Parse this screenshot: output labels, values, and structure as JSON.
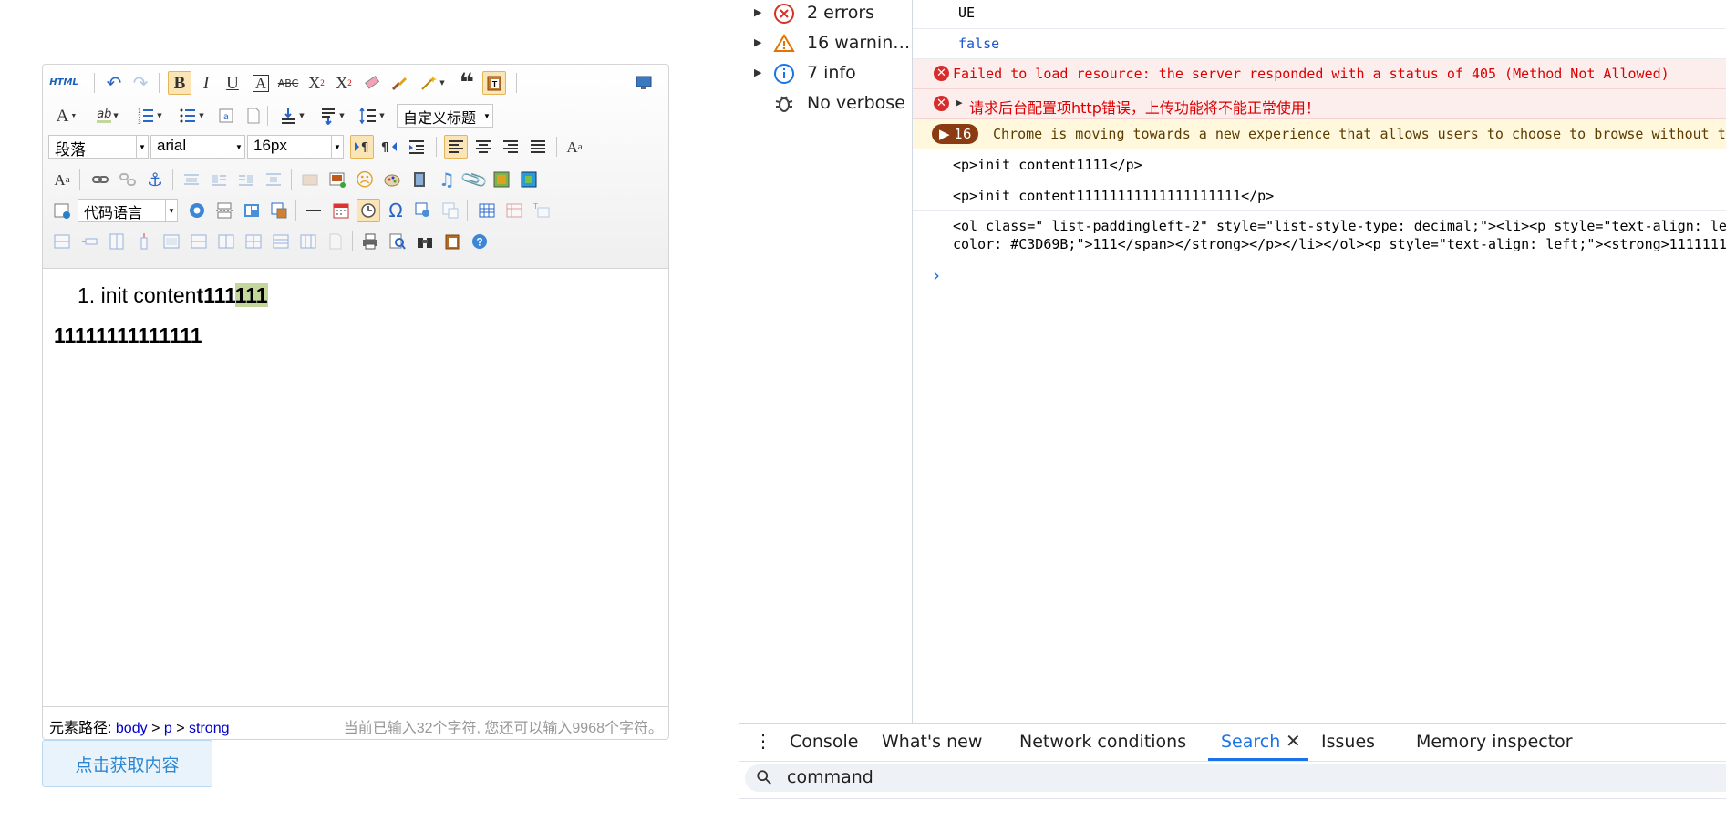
{
  "editor": {
    "toolbar": {
      "html_label": "HTML",
      "paragraph_value": "段落",
      "font_value": "arial",
      "size_value": "16px",
      "custom_title_value": "自定义标题",
      "code_language_value": "代码语言"
    },
    "content": {
      "list_marker": "1.",
      "list_text_normal": "init conten",
      "list_text_bold": "t111",
      "list_text_highlight": "111",
      "highlight_color": "#C3D69B",
      "para2": "11111111111111"
    },
    "statusbar": {
      "path_label": "元素路径:",
      "path_items": [
        "body",
        "p",
        "strong"
      ],
      "path_sep": ">",
      "count_text": "当前已输入32个字符, 您还可以输入9968个字符。"
    }
  },
  "get_button": {
    "label": "点击获取内容"
  },
  "devtools": {
    "sidebar": [
      {
        "label": "2 errors",
        "icon": "error-icon"
      },
      {
        "label": "16 warnin…",
        "icon": "warning-icon"
      },
      {
        "label": "7 info",
        "icon": "info-icon"
      },
      {
        "label": "No verbose",
        "icon": "bug-icon"
      }
    ],
    "console": {
      "line1": "UE",
      "line2": "false",
      "err1": "Failed to load resource: the server responded with a status of 405 (Method Not Allowed)",
      "err2": "请求后台配置项http错误，上传功能将不能正常使用！",
      "warn_count": "16",
      "warn_text": "Chrome is moving towards a new experience that allows users to choose to browse without t",
      "log1": "<p>init content1111</p>",
      "log2": "<p>init content11111111111111111111</p>",
      "log3a": "<ol class=\" list-paddingleft-2\" style=\"list-style-type: decimal;\"><li><p style=\"text-align: lef",
      "log3b": "color: #C3D69B;\">111</span></strong></p></li></ol><p style=\"text-align: left;\"><strong>1111111"
    },
    "drawer_tabs": [
      "Console",
      "What's new",
      "Network conditions",
      "Search",
      "Issues",
      "Memory inspector"
    ],
    "active_tab": "Search",
    "search_value": "command"
  }
}
